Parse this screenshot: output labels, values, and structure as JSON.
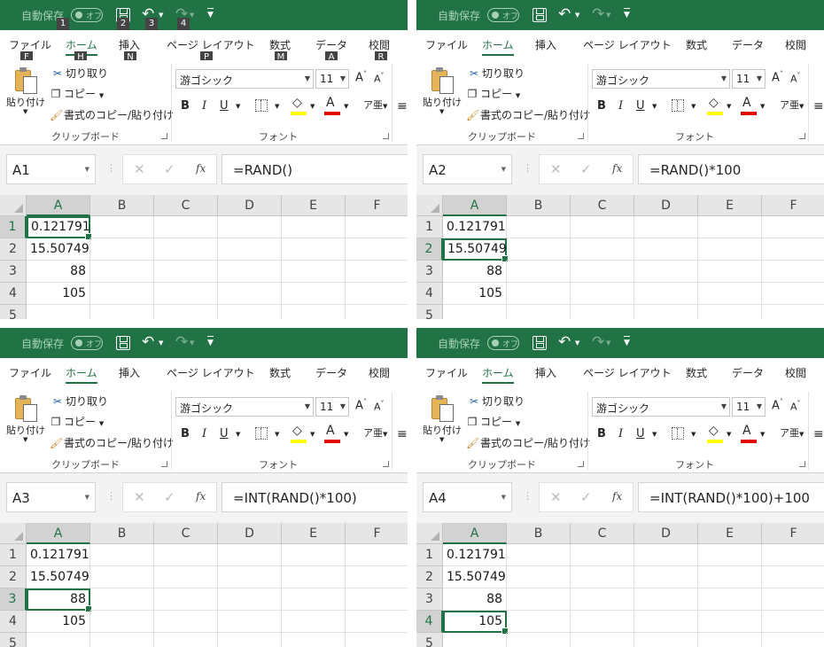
{
  "titlebar": {
    "autosave": "自動保存",
    "toggle": "オフ"
  },
  "tabs": {
    "file": "ファイル",
    "home": "ホーム",
    "insert": "挿入",
    "layout": "ページ レイアウト",
    "formulas": "数式",
    "data": "データ",
    "review": "校閲"
  },
  "keytips": {
    "qat_autosave": "1",
    "qat_save": "2",
    "qat_undo": "3",
    "qat_redo": "4",
    "file": "F",
    "home": "H",
    "insert": "N",
    "layout": "P",
    "formulas": "M",
    "data": "A",
    "review": "R"
  },
  "clipboard": {
    "paste": "貼り付け",
    "cut": "切り取り",
    "copy": "コピー",
    "painter": "書式のコピー/貼り付け",
    "group": "クリップボード"
  },
  "font": {
    "name": "游ゴシック",
    "size": "11",
    "group": "フォント",
    "bold": "B",
    "italic": "I",
    "underline": "U",
    "grow": "A",
    "shrink": "A",
    "color_letter": "A",
    "phonetic": "ア亜"
  },
  "colors": {
    "accent": "#217346",
    "fill": "#ffff00",
    "font_color": "#e00000"
  },
  "sheet": {
    "columns": [
      "A",
      "B",
      "C",
      "D",
      "E",
      "F"
    ],
    "rows": [
      "1",
      "2",
      "3",
      "4",
      "5"
    ],
    "values": [
      "0.121791",
      "15.50749",
      "88",
      "105"
    ]
  },
  "panels": [
    {
      "namebox": "A1",
      "formula": "=RAND()",
      "active_row": 1,
      "keytips_visible": true
    },
    {
      "namebox": "A2",
      "formula": "=RAND()*100",
      "active_row": 2,
      "keytips_visible": false
    },
    {
      "namebox": "A3",
      "formula": "=INT(RAND()*100)",
      "active_row": 3,
      "keytips_visible": false
    },
    {
      "namebox": "A4",
      "formula": "=INT(RAND()*100)+100",
      "active_row": 4,
      "keytips_visible": false
    }
  ]
}
